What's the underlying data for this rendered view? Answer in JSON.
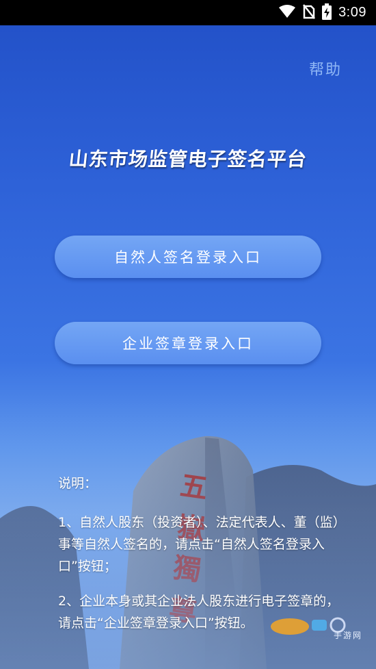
{
  "status_bar": {
    "time": "3:09",
    "icons": [
      "wifi-icon",
      "no-sim-icon",
      "battery-charging-icon"
    ]
  },
  "header": {
    "help_label": "帮助",
    "title": "山东市场监管电子签名平台"
  },
  "buttons": {
    "person_login": "自然人签名登录入口",
    "company_login": "企业签章登录入口"
  },
  "notes": {
    "heading": "说明：",
    "item1": "1、自然人股东（投资者）、法定代表人、董（监）事等自然人签名的，请点击“自然人签名登录入口”按钮；",
    "item2": "2、企业本身或其企业法人股东进行电子签章的，请点击“企业签章登录入口”按钮。"
  },
  "watermark": {
    "logo_text": "手游网"
  },
  "colors": {
    "background_top": "#2352c9",
    "background_bottom": "#7aa9ee",
    "button_fill": "#6a9df2",
    "help_text": "#8fb6f5"
  }
}
